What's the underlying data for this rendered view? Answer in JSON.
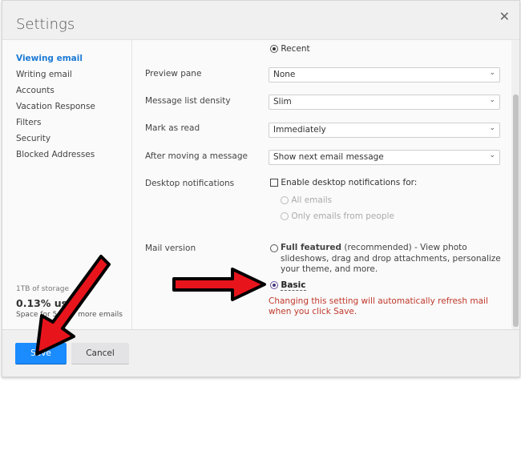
{
  "dialog": {
    "title": "Settings",
    "close_icon": "close-icon"
  },
  "nav": {
    "items": [
      {
        "label": "Viewing email",
        "active": true
      },
      {
        "label": "Writing email",
        "active": false
      },
      {
        "label": "Accounts",
        "active": false
      },
      {
        "label": "Vacation Response",
        "active": false
      },
      {
        "label": "Filters",
        "active": false
      },
      {
        "label": "Security",
        "active": false
      },
      {
        "label": "Blocked Addresses",
        "active": false
      }
    ],
    "storage": {
      "capacity": "1TB of storage",
      "used": "0.13% used",
      "space_prefix": "Space for 5",
      "space_suffix": "more emails"
    }
  },
  "settings": {
    "sort_option": {
      "label": "Recent",
      "selected": true
    },
    "preview_pane": {
      "label": "Preview pane",
      "value": "None"
    },
    "message_list_density": {
      "label": "Message list density",
      "value": "Slim"
    },
    "mark_as_read": {
      "label": "Mark as read",
      "value": "Immediately"
    },
    "after_moving": {
      "label": "After moving a message",
      "value": "Show next email message"
    },
    "desktop_notifications": {
      "label": "Desktop notifications",
      "checkbox_label": "Enable desktop notifications for:",
      "checked": false,
      "options": [
        {
          "label": "All emails",
          "disabled": true
        },
        {
          "label": "Only emails from people",
          "disabled": true
        }
      ]
    },
    "mail_version": {
      "label": "Mail version",
      "full_featured": {
        "name": "Full featured",
        "description": " (recommended) - View photo slideshows, drag and drop attachments, personalize your theme, and more.",
        "selected": false
      },
      "basic": {
        "name": "Basic",
        "selected": true
      },
      "warning": "Changing this setting will automatically refresh mail when you click Save."
    }
  },
  "footer": {
    "save_label": "Save",
    "cancel_label": "Cancel"
  },
  "annotations": {
    "arrow_color": "#e8141c",
    "arrows": [
      "points-to-basic-option",
      "points-to-save-button"
    ]
  }
}
